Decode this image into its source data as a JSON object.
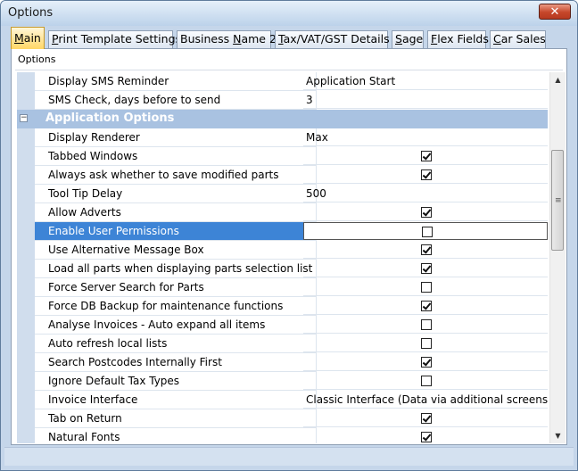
{
  "window": {
    "title": "Options",
    "close_glyph": "✕"
  },
  "tabs": [
    {
      "pre": "",
      "key": "M",
      "post": "ain",
      "active": true
    },
    {
      "pre": "",
      "key": "P",
      "post": "rint Template Settings",
      "active": false
    },
    {
      "pre": "Business ",
      "key": "N",
      "post": "ame 2",
      "active": false
    },
    {
      "pre": "",
      "key": "T",
      "post": "ax/VAT/GST Details",
      "active": false
    },
    {
      "pre": "",
      "key": "S",
      "post": "age",
      "active": false
    },
    {
      "pre": "",
      "key": "F",
      "post": "lex Fields",
      "active": false
    },
    {
      "pre": "",
      "key": "C",
      "post": "ar Sales",
      "active": false
    }
  ],
  "group_label": "Options",
  "grid": {
    "rows": [
      {
        "name": "Display SMS Reminder",
        "value": "Application Start"
      },
      {
        "name": "SMS Check, days before to send",
        "value": "3"
      },
      {
        "category": "Application Options",
        "expander": "−"
      },
      {
        "name": "Display Renderer",
        "value": "Max"
      },
      {
        "name": "Tabbed Windows",
        "checkbox": true
      },
      {
        "name": "Always ask whether to save modified parts",
        "checkbox": true
      },
      {
        "name": "Tool Tip Delay",
        "value": "500"
      },
      {
        "name": "Allow Adverts",
        "checkbox": true
      },
      {
        "name": "Enable User Permissions",
        "checkbox": false,
        "selected": true
      },
      {
        "name": "Use Alternative Message Box",
        "checkbox": true
      },
      {
        "name": "Load all parts when displaying parts selection list",
        "checkbox": true
      },
      {
        "name": "Force Server Search for Parts",
        "checkbox": false
      },
      {
        "name": "Force DB Backup for maintenance functions",
        "checkbox": true
      },
      {
        "name": "Analyse Invoices - Auto expand all items",
        "checkbox": false
      },
      {
        "name": "Auto refresh local lists",
        "checkbox": false
      },
      {
        "name": "Search Postcodes Internally First",
        "checkbox": true
      },
      {
        "name": "Ignore Default Tax Types",
        "checkbox": false
      },
      {
        "name": "Invoice Interface",
        "value": "Classic Interface (Data via additional screens)"
      },
      {
        "name": "Tab on Return",
        "checkbox": true
      },
      {
        "name": "Natural Fonts",
        "checkbox": true
      }
    ]
  },
  "scrollbar": {
    "up_glyph": "▲",
    "down_glyph": "▼",
    "grip_glyph": "≡"
  }
}
